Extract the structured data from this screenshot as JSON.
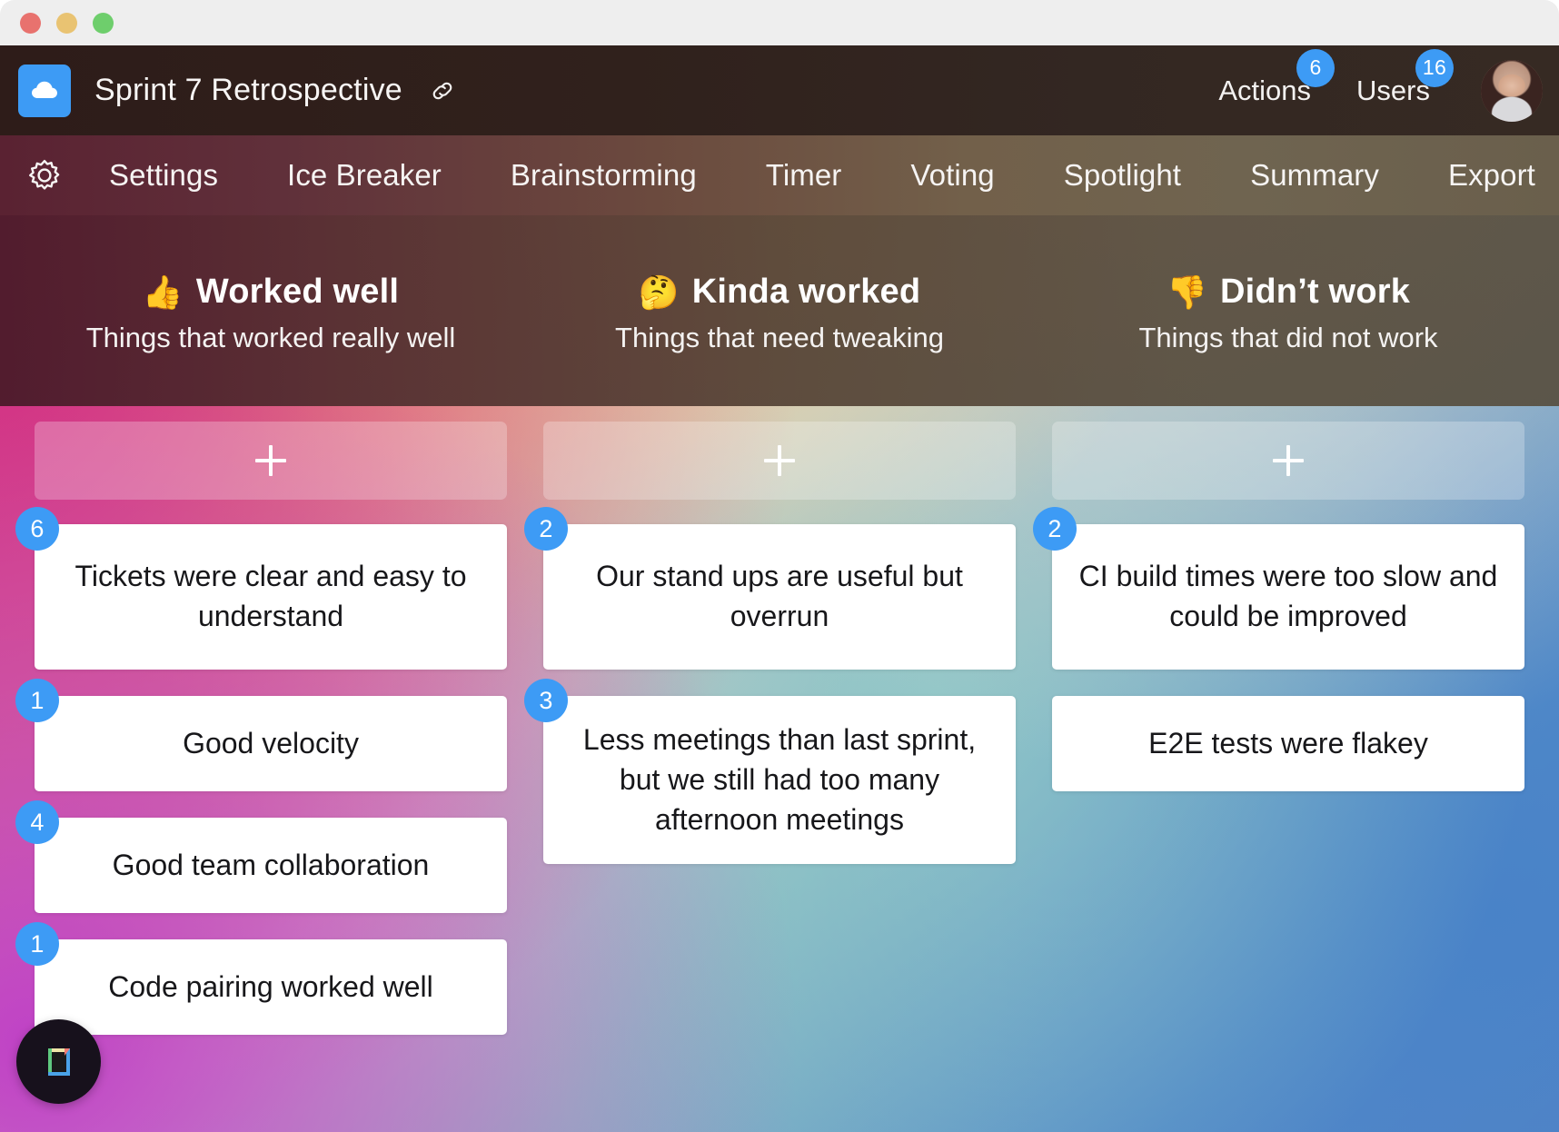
{
  "window": {
    "traffic_lights": [
      "close",
      "minimize",
      "zoom"
    ],
    "colors": {
      "close": "#e8726e",
      "minimize": "#e9c372",
      "zoom": "#6ece6c",
      "accent_blue": "#3d9bf5",
      "topbar": "#2e1c19",
      "navbar_left": "#5a2232",
      "navbar_right": "#6a5f4c"
    }
  },
  "topbar": {
    "logo_icon": "cloud-icon",
    "title": "Sprint 7 Retrospective",
    "link_icon": "link-icon",
    "actions": {
      "label": "Actions",
      "count": "6"
    },
    "users": {
      "label": "Users",
      "count": "16"
    },
    "avatar_name": "user-avatar"
  },
  "nav": {
    "gear_icon": "gear-icon",
    "items": [
      {
        "label": "Settings"
      },
      {
        "label": "Ice Breaker"
      },
      {
        "label": "Brainstorming"
      },
      {
        "label": "Timer"
      },
      {
        "label": "Voting"
      },
      {
        "label": "Spotlight"
      },
      {
        "label": "Summary"
      },
      {
        "label": "Export"
      }
    ]
  },
  "columns": [
    {
      "emoji": "👍",
      "emoji_name": "thumbs-up-emoji",
      "title": "Worked well",
      "subtitle": "Things that worked really well",
      "add_label": "+",
      "cards": [
        {
          "votes": "6",
          "text": "Tickets were clear and easy to understand",
          "size": "h-tall"
        },
        {
          "votes": "1",
          "text": "Good velocity",
          "size": "h-mid"
        },
        {
          "votes": "4",
          "text": "Good team collaboration",
          "size": "h-mid"
        },
        {
          "votes": "1",
          "text": "Code pairing worked well",
          "size": "h-mid"
        }
      ]
    },
    {
      "emoji": "🤔",
      "emoji_name": "thinking-face-emoji",
      "title": "Kinda worked",
      "subtitle": "Things that need tweaking",
      "add_label": "+",
      "cards": [
        {
          "votes": "2",
          "text": "Our stand ups are useful but overrun",
          "size": "h-tall"
        },
        {
          "votes": "3",
          "text": "Less meetings than last sprint, but we still had too many afternoon meetings",
          "size": "h-tall"
        }
      ]
    },
    {
      "emoji": "👎",
      "emoji_name": "thumbs-down-emoji",
      "title": "Didn’t work",
      "subtitle": "Things that did not work",
      "add_label": "+",
      "cards": [
        {
          "votes": "2",
          "text": "CI build times were too slow and could be improved",
          "size": "h-tall"
        },
        {
          "votes": "",
          "text": "E2E tests were flakey",
          "size": "h-mid"
        }
      ]
    }
  ],
  "fab": {
    "icon_name": "notes-icon"
  }
}
